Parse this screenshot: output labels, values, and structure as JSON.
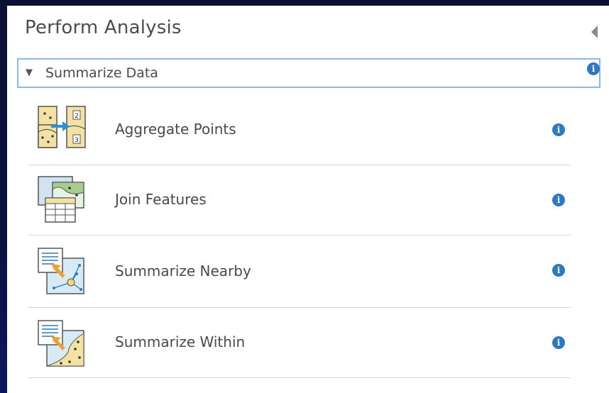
{
  "panel": {
    "title": "Perform Analysis",
    "collapse_icon": "chevron-left-icon"
  },
  "section": {
    "caret_icon": "caret-down-icon",
    "title": "Summarize Data",
    "info_icon": "info-icon",
    "info_glyph": "i"
  },
  "tools": [
    {
      "label": "Aggregate Points",
      "icon": "aggregate-points-icon",
      "info_glyph": "i"
    },
    {
      "label": "Join Features",
      "icon": "join-features-icon",
      "info_glyph": "i"
    },
    {
      "label": "Summarize Nearby",
      "icon": "summarize-nearby-icon",
      "info_glyph": "i"
    },
    {
      "label": "Summarize Within",
      "icon": "summarize-within-icon",
      "info_glyph": "i"
    }
  ],
  "colors": {
    "accent": "#2e79c0",
    "focus_border": "#8fb7e6",
    "background": "#0b1033"
  }
}
